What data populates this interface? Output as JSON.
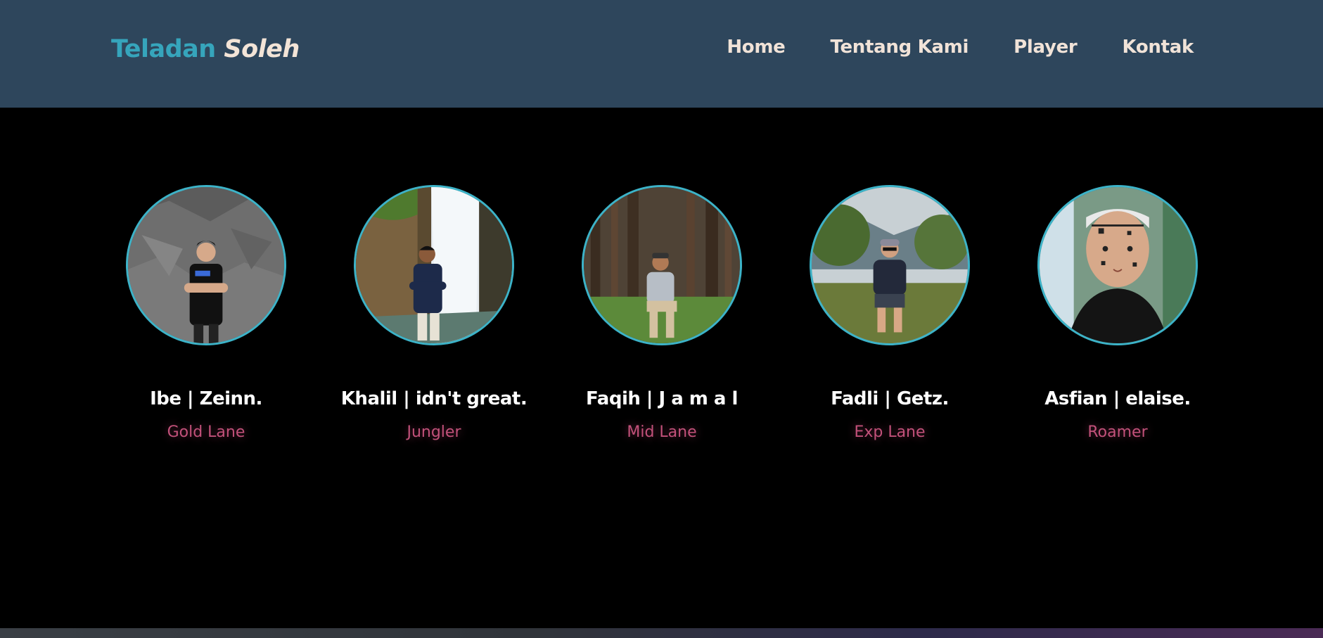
{
  "brand": {
    "first": "Teladan",
    "second": "Soleh"
  },
  "nav": {
    "items": [
      {
        "label": "Home"
      },
      {
        "label": "Tentang Kami"
      },
      {
        "label": "Player"
      },
      {
        "label": "Kontak"
      }
    ]
  },
  "players": [
    {
      "name": "Ibe | Zeinn.",
      "role": "Gold Lane",
      "photo": "player-photo-rock-wall"
    },
    {
      "name": "Khalil | idn't great.",
      "role": "Jungler",
      "photo": "player-photo-waterfall"
    },
    {
      "name": "Faqih | J a m a l",
      "role": "Mid Lane",
      "photo": "player-photo-pine-forest"
    },
    {
      "name": "Fadli | Getz.",
      "role": "Exp Lane",
      "photo": "player-photo-mountain-trees"
    },
    {
      "name": "Asfian | elaise.",
      "role": "Roamer",
      "photo": "player-photo-selfie"
    }
  ],
  "colors": {
    "navbar": "#2e465c",
    "brand_accent": "#36a5bc",
    "brand_light": "#f3e4d7",
    "avatar_border": "#3cb3c8",
    "role_text": "#c2517a",
    "background": "#000000"
  }
}
